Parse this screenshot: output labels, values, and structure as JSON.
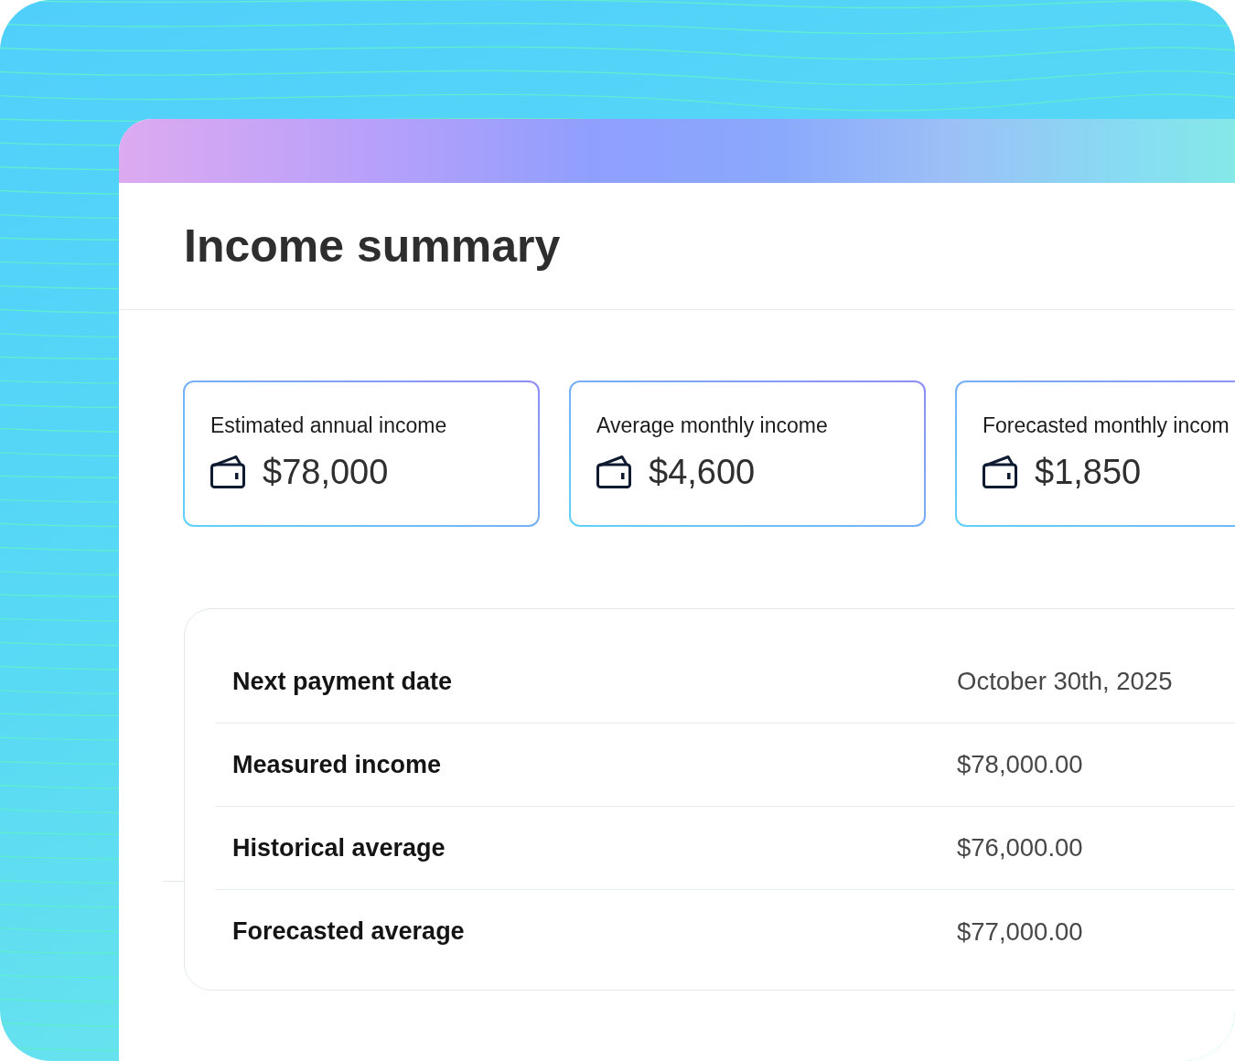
{
  "page": {
    "title": "Income summary"
  },
  "stat_cards": [
    {
      "label": "Estimated annual income",
      "value": "$78,000"
    },
    {
      "label": "Average monthly income",
      "value": "$4,600"
    },
    {
      "label": "Forecasted monthly incom",
      "value": "$1,850"
    }
  ],
  "details": [
    {
      "label": "Next payment date",
      "value": "October 30th, 2025"
    },
    {
      "label": "Measured income",
      "value": "$78,000.00"
    },
    {
      "label": "Historical average",
      "value": "$76,000.00"
    },
    {
      "label": "Forecasted average",
      "value": "$77,000.00"
    }
  ]
}
